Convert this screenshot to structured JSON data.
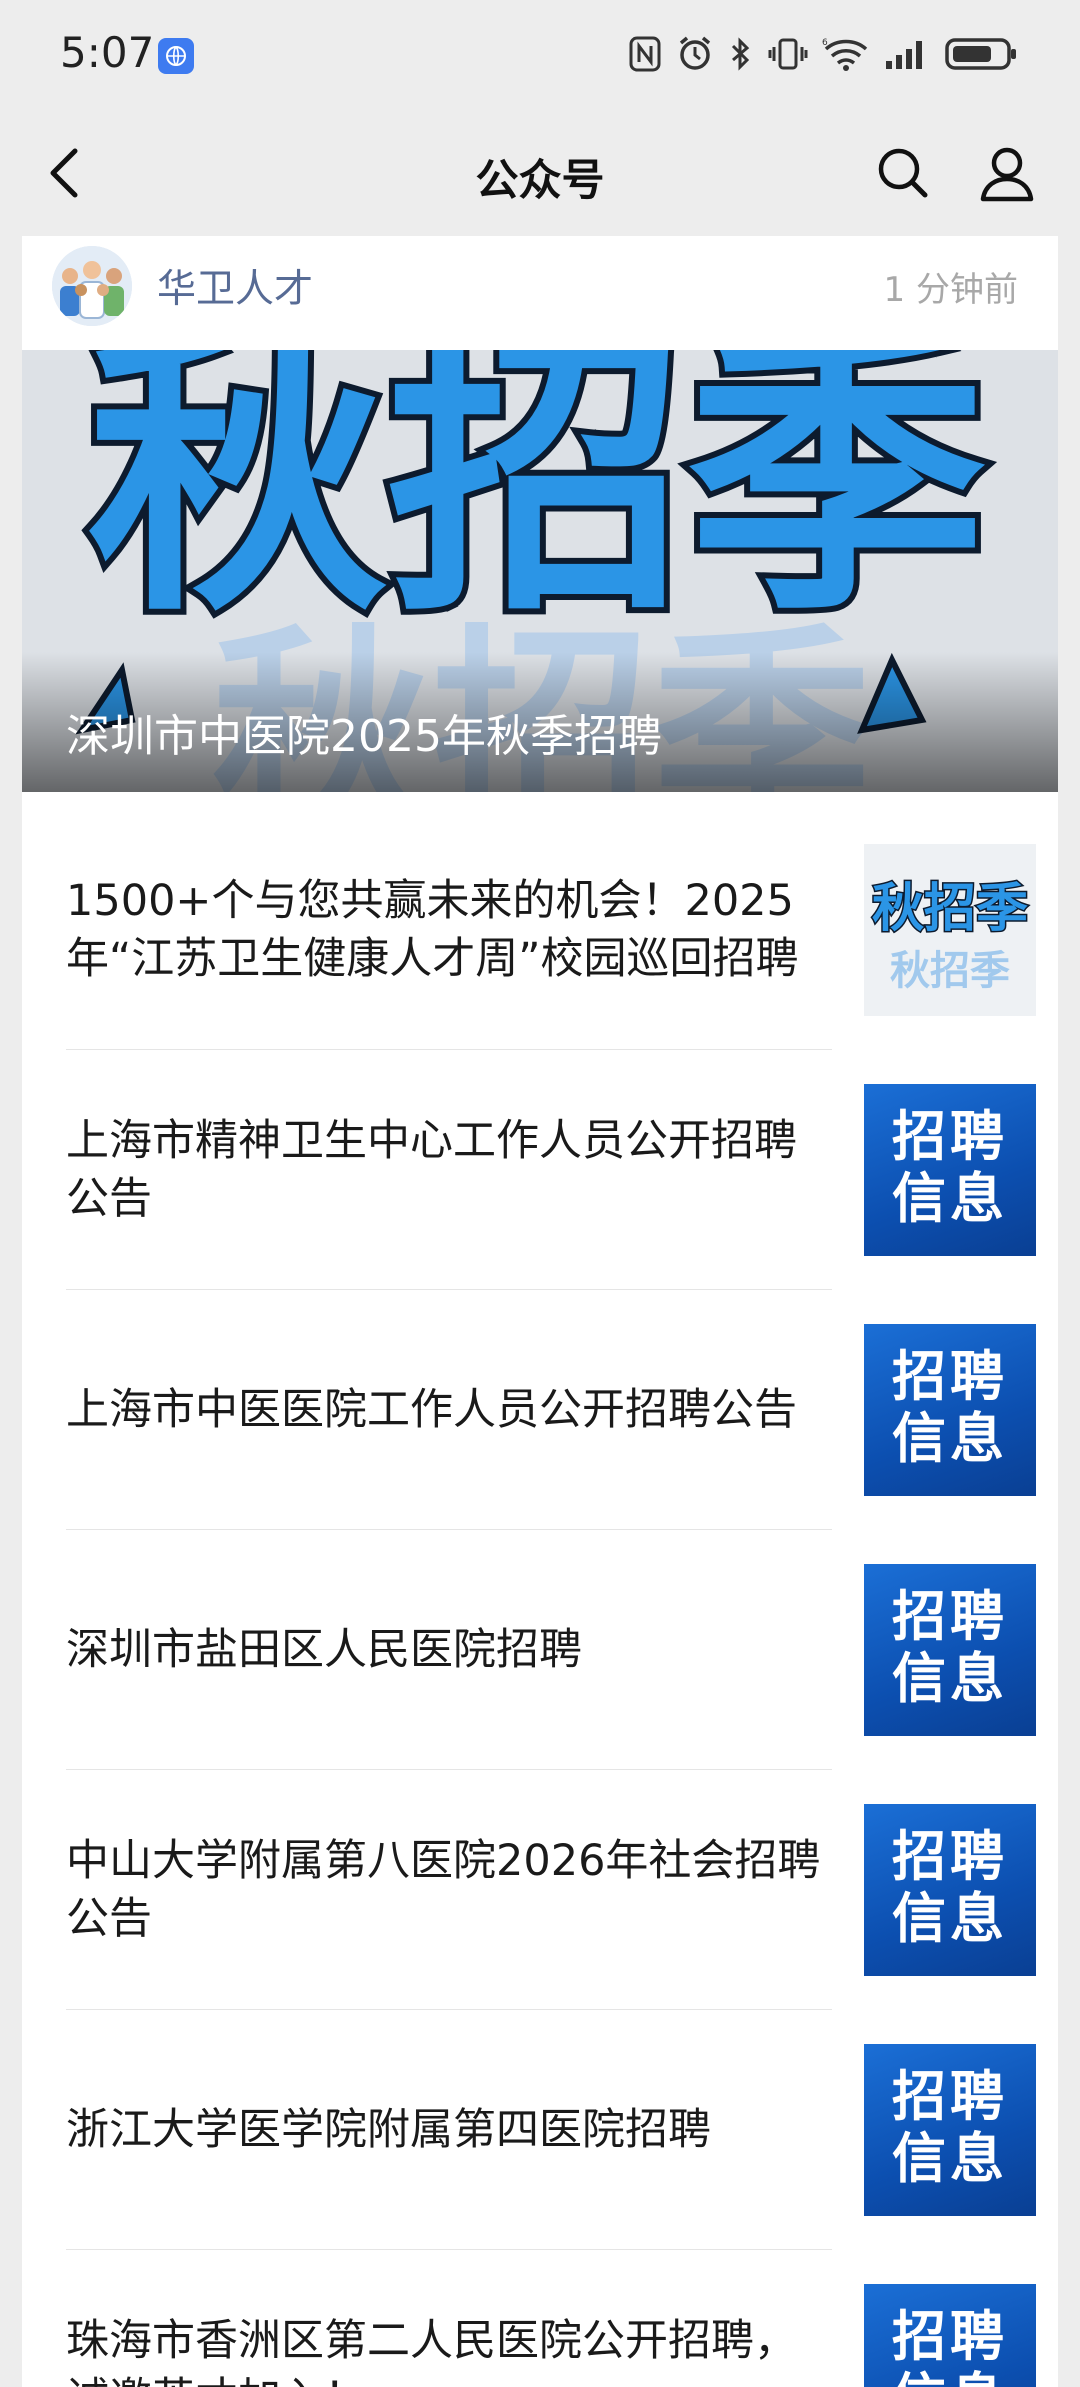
{
  "status_bar": {
    "time": "5:07"
  },
  "nav": {
    "title": "公众号"
  },
  "account": {
    "name": "华卫人才",
    "time": "1 分钟前"
  },
  "hero": {
    "title": "深圳市中医院2025年秋季招聘",
    "image_text": "秋招季"
  },
  "articles": [
    {
      "title": "1500+个与您共赢未来的机会！2025年“江苏卫生健康人才周”校园巡回招聘",
      "thumb": "qiuzhaoji"
    },
    {
      "title": "上海市精神卫生中心工作人员公开招聘公告",
      "thumb": "zhaopin"
    },
    {
      "title": "上海市中医医院工作人员公开招聘公告",
      "thumb": "zhaopin"
    },
    {
      "title": "深圳市盐田区人民医院招聘",
      "thumb": "zhaopin"
    },
    {
      "title": "中山大学附属第八医院2026年社会招聘公告",
      "thumb": "zhaopin"
    },
    {
      "title": "浙江大学医学院附属第四医院招聘",
      "thumb": "zhaopin"
    },
    {
      "title": "珠海市香洲区第二人民医院公开招聘，诚邀英才加入！",
      "thumb": "zhaopin"
    }
  ],
  "thumb_labels": {
    "zhaopin_line1": "招聘",
    "zhaopin_line2": "信息",
    "qiu_top": "秋招季"
  },
  "colors": {
    "background": "#ededed",
    "account_name": "#576b95",
    "thumb_blue": "#1b6fd6"
  }
}
